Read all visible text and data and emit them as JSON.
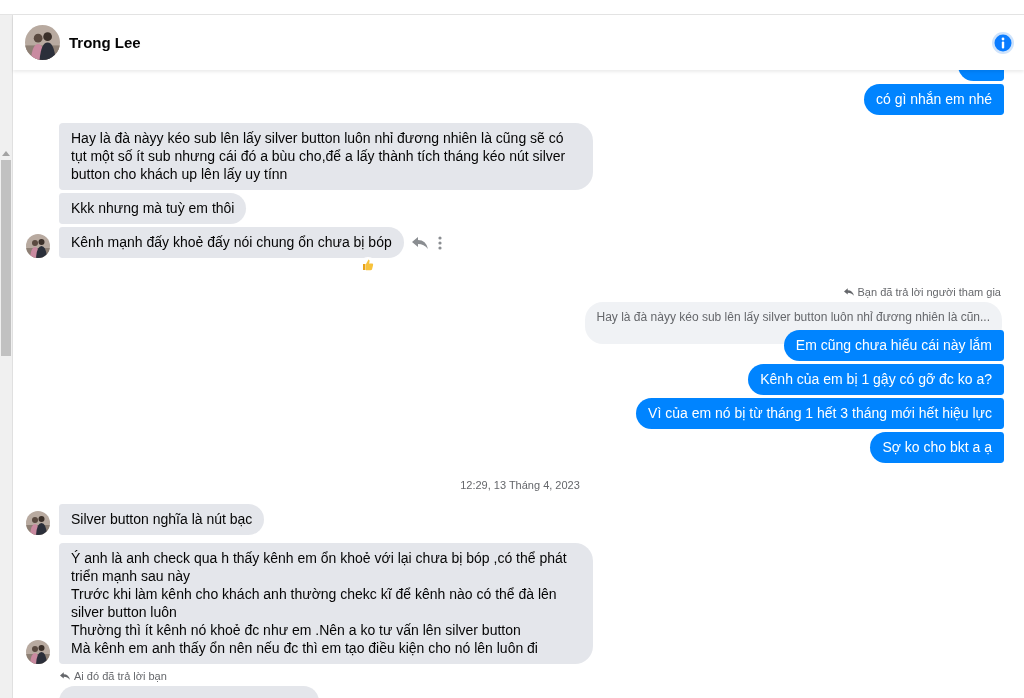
{
  "header": {
    "name": "Trong Lee"
  },
  "messages": [
    {
      "kind": "clipped_out"
    },
    {
      "kind": "outgoing",
      "text": "có gì nhắn em nhé"
    },
    {
      "kind": "incoming",
      "avatar": false,
      "reaction": false,
      "actions": false,
      "text": "Hay là đà nàyy kéo sub lên lấy silver button luôn nhỉ đương nhiên là cũng sẽ có tụt một số ít sub nhưng cái đó a bùu cho,để a lấy thành tích tháng kéo nút silver button cho khách up lên lấy uy tínn"
    },
    {
      "kind": "incoming",
      "avatar": false,
      "reaction": false,
      "actions": false,
      "text": "Kkk nhưng mà tuỳ em thôi"
    },
    {
      "kind": "incoming",
      "avatar": true,
      "reaction": true,
      "actions": true,
      "text": "Kênh mạnh đấy khoẻ đấy nói chung ổn chưa bị bóp"
    },
    {
      "kind": "reply_note_sent",
      "text": "Bạn đã trả lời người tham gia"
    },
    {
      "kind": "quote",
      "text": "Hay là đà nàyy kéo sub lên lấy silver button luôn nhỉ đương nhiên là cũn..."
    },
    {
      "kind": "outgoing",
      "text": "Em cũng chưa hiểu cái này lắm"
    },
    {
      "kind": "outgoing",
      "text": "Kênh của em bị 1 gậy có gỡ đc ko a?"
    },
    {
      "kind": "outgoing",
      "text": "Vì của em nó bị từ tháng 1 hết 3 tháng mới hết hiệu lực"
    },
    {
      "kind": "outgoing",
      "text": "Sợ ko cho bkt a ạ"
    },
    {
      "kind": "timestamp",
      "text": "12:29, 13 Tháng 4, 2023"
    },
    {
      "kind": "incoming",
      "avatar": true,
      "reaction": false,
      "actions": false,
      "text": "Silver button nghĩa là nút bạc"
    },
    {
      "kind": "incoming",
      "avatar": true,
      "reaction": false,
      "actions": false,
      "text": "Ý anh là anh check qua h thấy kênh em ổn khoẻ với lại chưa bị bóp ,có thể phát triển mạnh sau này\nTrước khi làm kênh cho khách anh thường chekc kĩ để kênh nào có thể đà lên silver button luôn\nThường thì ít kênh nó khoẻ đc như em .Nên a ko tư vấn lên silver button\nMà kênh em anh thấy ổn nên nếu đc thì em tạo điều kiện cho nó lên luôn đi"
    },
    {
      "kind": "reply_note_received",
      "text": "Ai đó đã trả lời bạn"
    },
    {
      "kind": "clipped_in"
    }
  ]
}
